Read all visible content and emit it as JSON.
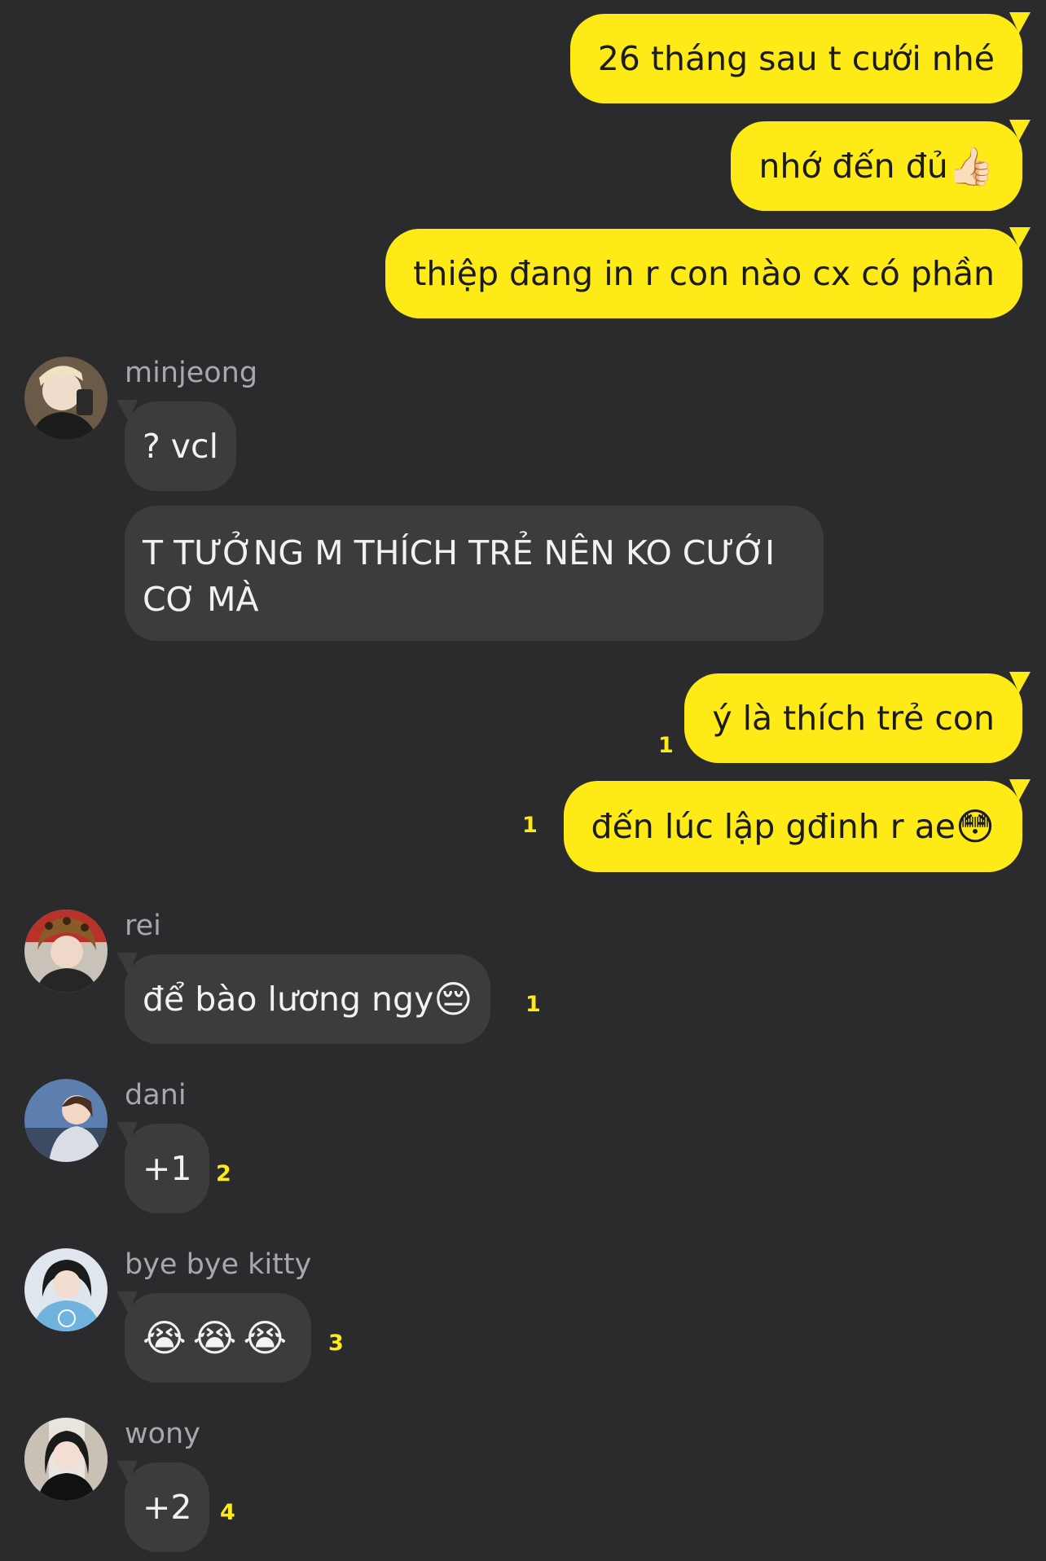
{
  "chat": {
    "messages_me_top": [
      {
        "text": "26 tháng sau t cưới nhé"
      },
      {
        "text": "nhớ đến đủ",
        "emoji": "👍🏻"
      },
      {
        "text": "thiệp đang in r con nào cx có phần"
      }
    ],
    "minjeong": {
      "name": "minjeong",
      "msg1": "? vcl",
      "msg2": "T TƯỞNG M THÍCH TRẺ NÊN KO CƯỚI CƠ MÀ"
    },
    "messages_me_mid": [
      {
        "text": "ý là thích trẻ con",
        "unread": "1"
      },
      {
        "text": "đến lúc lập gđinh r ae",
        "emoji": "😳",
        "unread": "1"
      }
    ],
    "rei": {
      "name": "rei",
      "msg": "để bào lương ngy",
      "emoji": "😔",
      "unread": "1"
    },
    "dani": {
      "name": "dani",
      "msg": "+1",
      "unread": "2"
    },
    "kitty": {
      "name": "bye bye kitty",
      "msg": "😭😭😭",
      "unread": "3"
    },
    "wony": {
      "name": "wony",
      "msg": "+2",
      "unread": "4"
    }
  },
  "colors": {
    "background": "#2b2b2d",
    "my_bubble": "#fdea16",
    "their_bubble": "#3c3c3f",
    "unread_count": "#fdea16",
    "sender_name": "#a8a8ac"
  },
  "icons": {
    "avatar_minjeong": "avatar-photo",
    "avatar_rei": "avatar-photo",
    "avatar_dani": "avatar-photo",
    "avatar_kitty": "avatar-photo",
    "avatar_wony": "avatar-photo"
  }
}
